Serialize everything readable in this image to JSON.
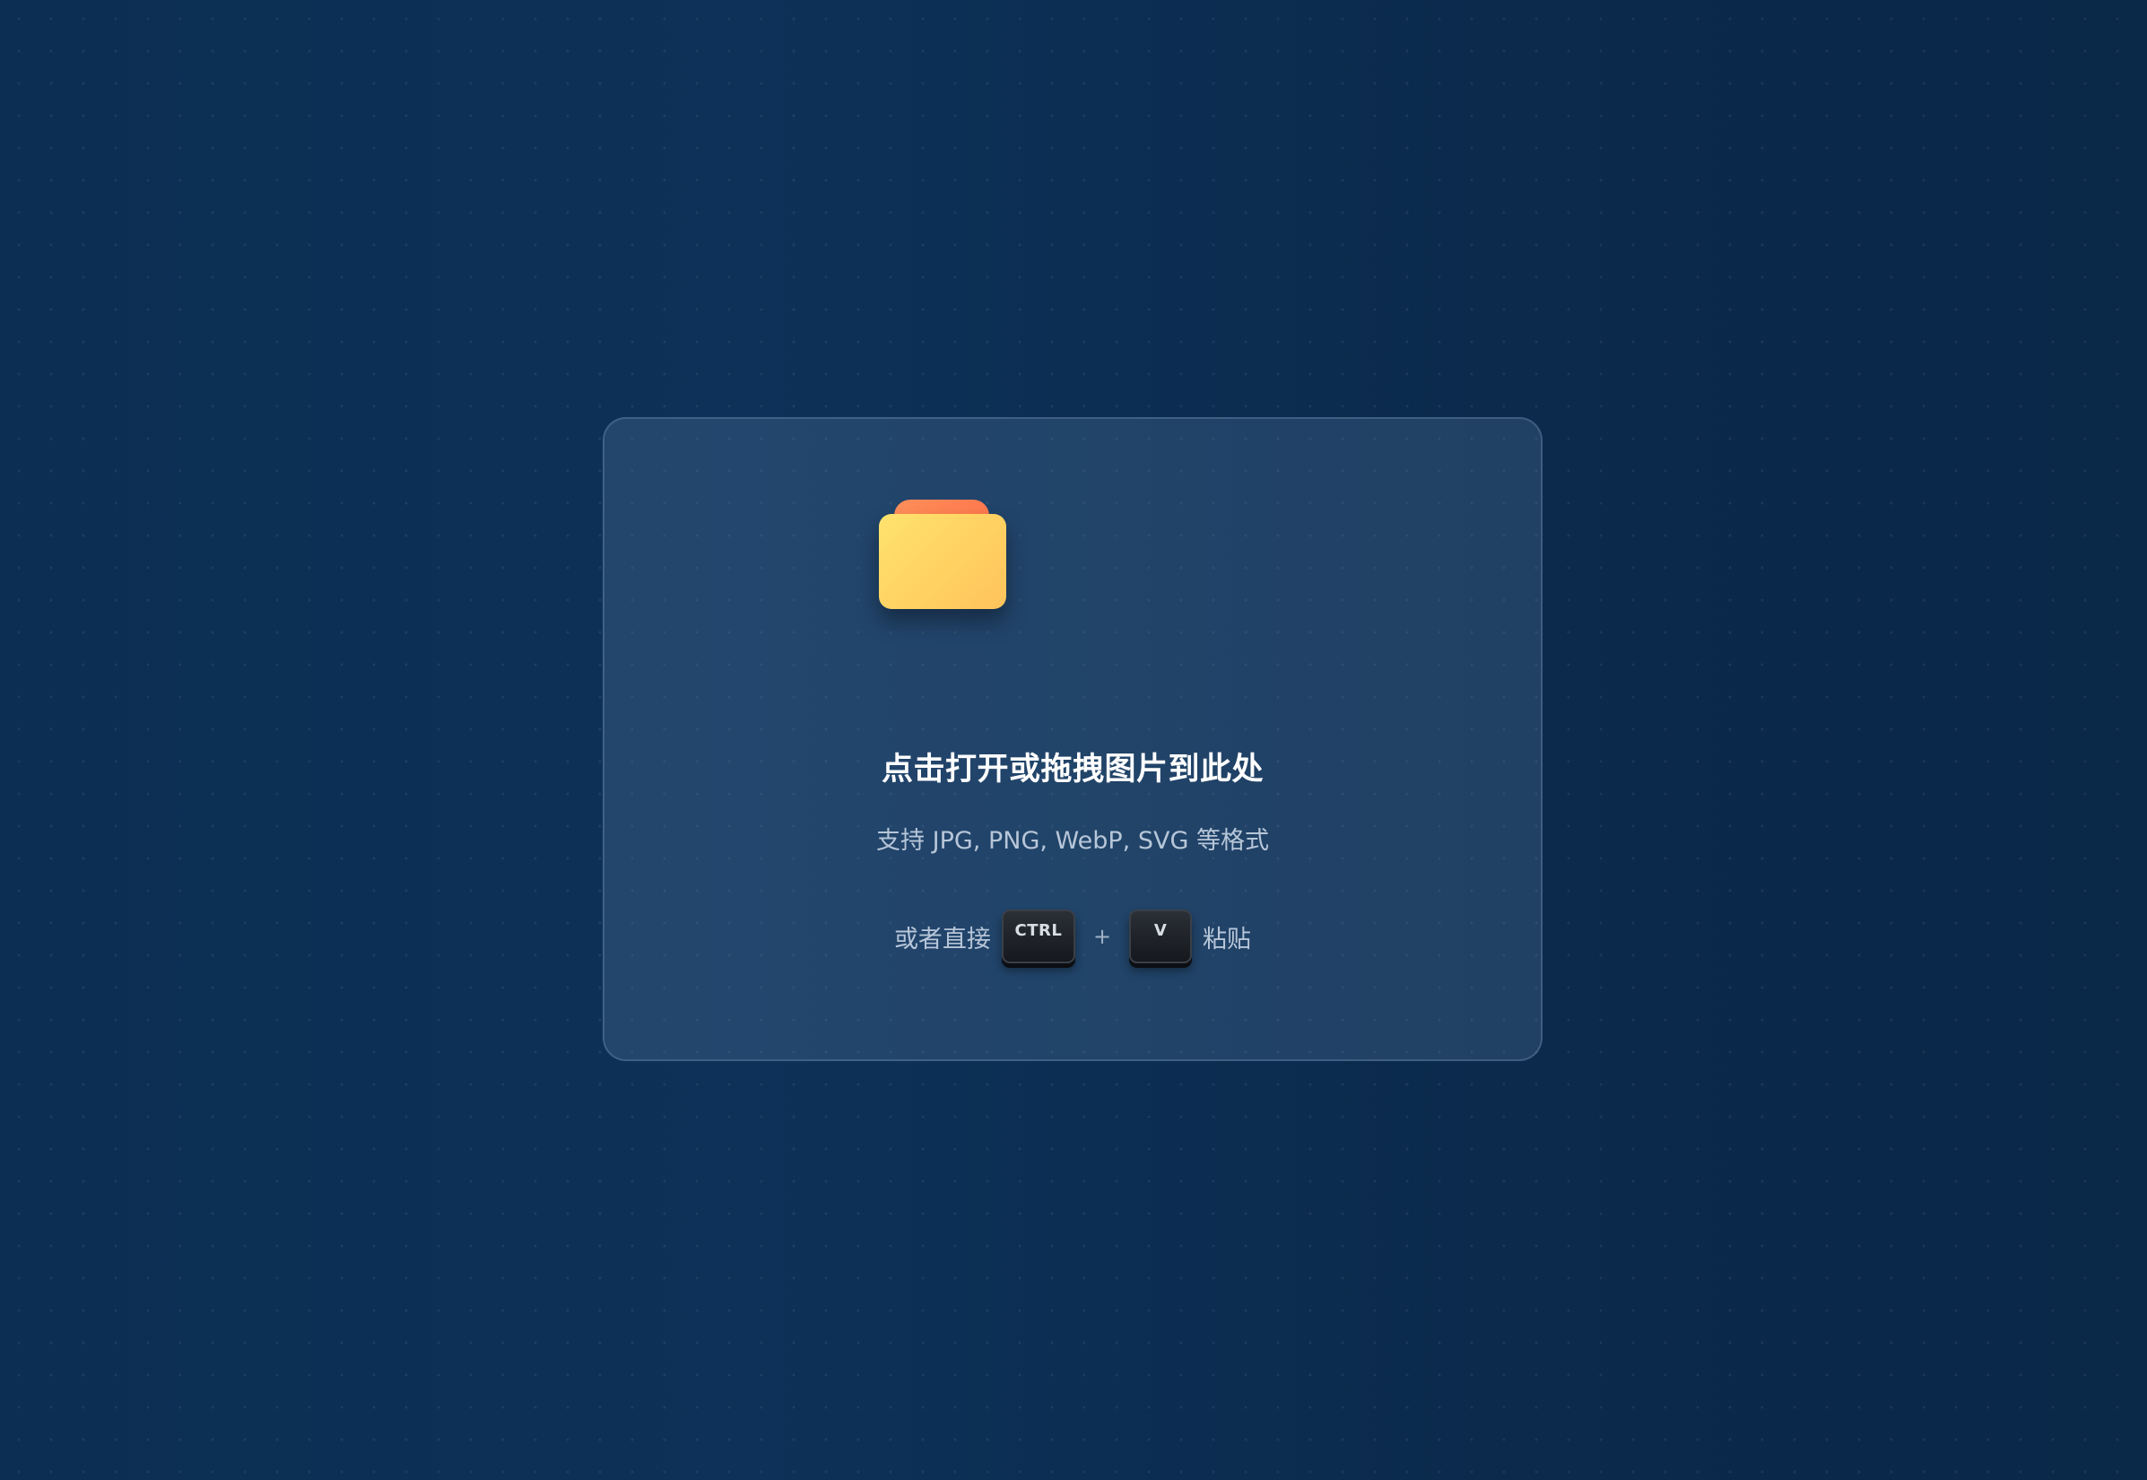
{
  "upload": {
    "title": "点击打开或拖拽图片到此处",
    "subtitle": "支持 JPG, PNG, WebP, SVG 等格式",
    "paste_hint": {
      "prefix": "或者直接",
      "key_ctrl": "CTRL",
      "plus": "+",
      "key_v": "V",
      "suffix": "粘贴"
    }
  },
  "colors": {
    "background": "#0c2b4d",
    "card": "#2a4866",
    "folder_tab": "#ff7a4f",
    "folder_body": "#ffd162"
  },
  "icons": {
    "folder": "folder-icon"
  }
}
